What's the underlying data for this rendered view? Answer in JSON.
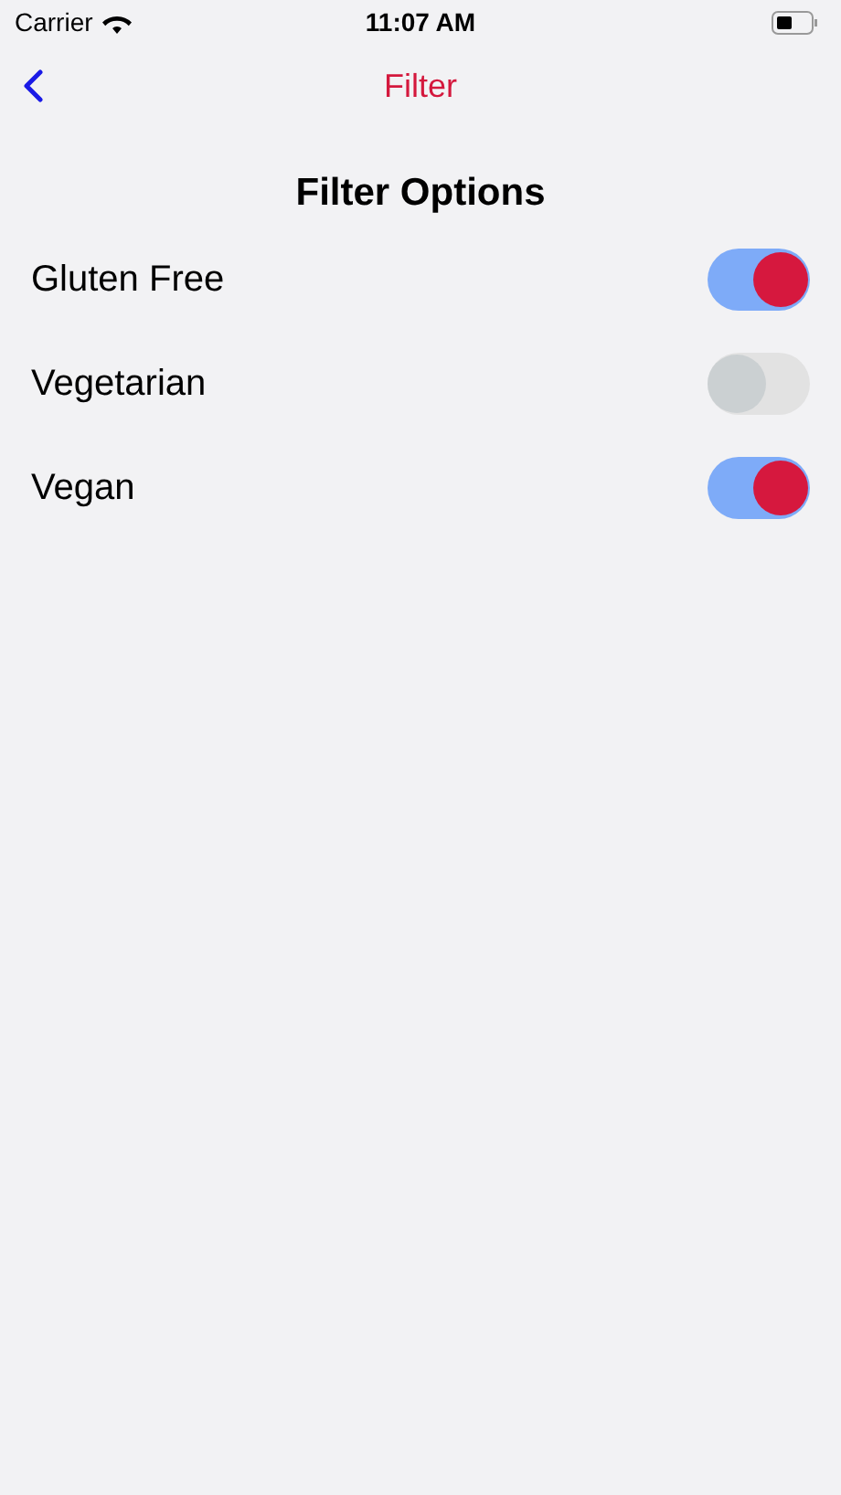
{
  "status_bar": {
    "carrier": "Carrier",
    "time": "11:07 AM"
  },
  "nav": {
    "title": "Filter"
  },
  "heading": "Filter Options",
  "filters": [
    {
      "label": "Gluten Free",
      "on": true
    },
    {
      "label": "Vegetarian",
      "on": false
    },
    {
      "label": "Vegan",
      "on": true
    }
  ]
}
